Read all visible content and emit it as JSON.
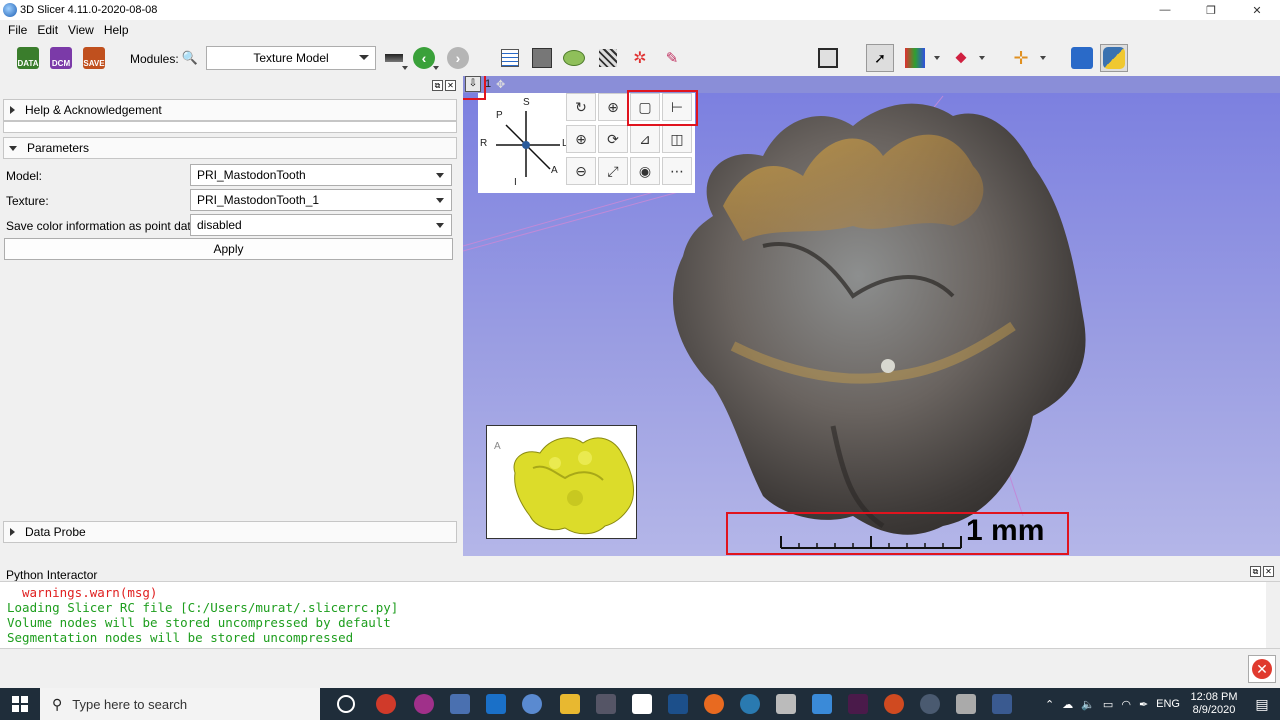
{
  "window": {
    "title": "3D Slicer 4.11.0-2020-08-08",
    "controls": [
      "—",
      "❐",
      "✕"
    ]
  },
  "menu": [
    "File",
    "Edit",
    "View",
    "Help"
  ],
  "toolbar": {
    "data_label": "DATA",
    "dcm_label": "DCM",
    "save_label": "SAVE",
    "modules_label": "Modules:",
    "module_selected": "Texture Model"
  },
  "left_panel": {
    "help_section": "Help & Acknowledgement",
    "parameters_section": "Parameters",
    "model_label": "Model:",
    "model_value": "PRI_MastodonTooth",
    "texture_label": "Texture:",
    "texture_value": "PRI_MastodonTooth_1",
    "save_color_label": "Save color information as point data:",
    "save_color_value": "disabled",
    "apply_label": "Apply",
    "data_probe_section": "Data Probe"
  },
  "view3d": {
    "view_number": "1",
    "orientation": {
      "S": "S",
      "I": "I",
      "P": "P",
      "A": "A",
      "R": "R",
      "L": "L"
    },
    "ruler_label": "1 mm",
    "inset_label": "A"
  },
  "python": {
    "title": "Python Interactor",
    "lines": [
      "warnings.warn(msg)",
      "Loading Slicer RC file [C:/Users/murat/.slicerrc.py]",
      "Volume nodes will be stored uncompressed by default",
      "Segmentation nodes will be stored uncompressed"
    ]
  },
  "taskbar": {
    "search_placeholder": "Type here to search",
    "language": "ENG",
    "time": "12:08 PM",
    "date": "8/9/2020"
  },
  "colors": {
    "highlight_red": "#e0141e",
    "view_background": "#8a8ed8",
    "console_green": "#1e9e1e",
    "console_red": "#e02020"
  }
}
